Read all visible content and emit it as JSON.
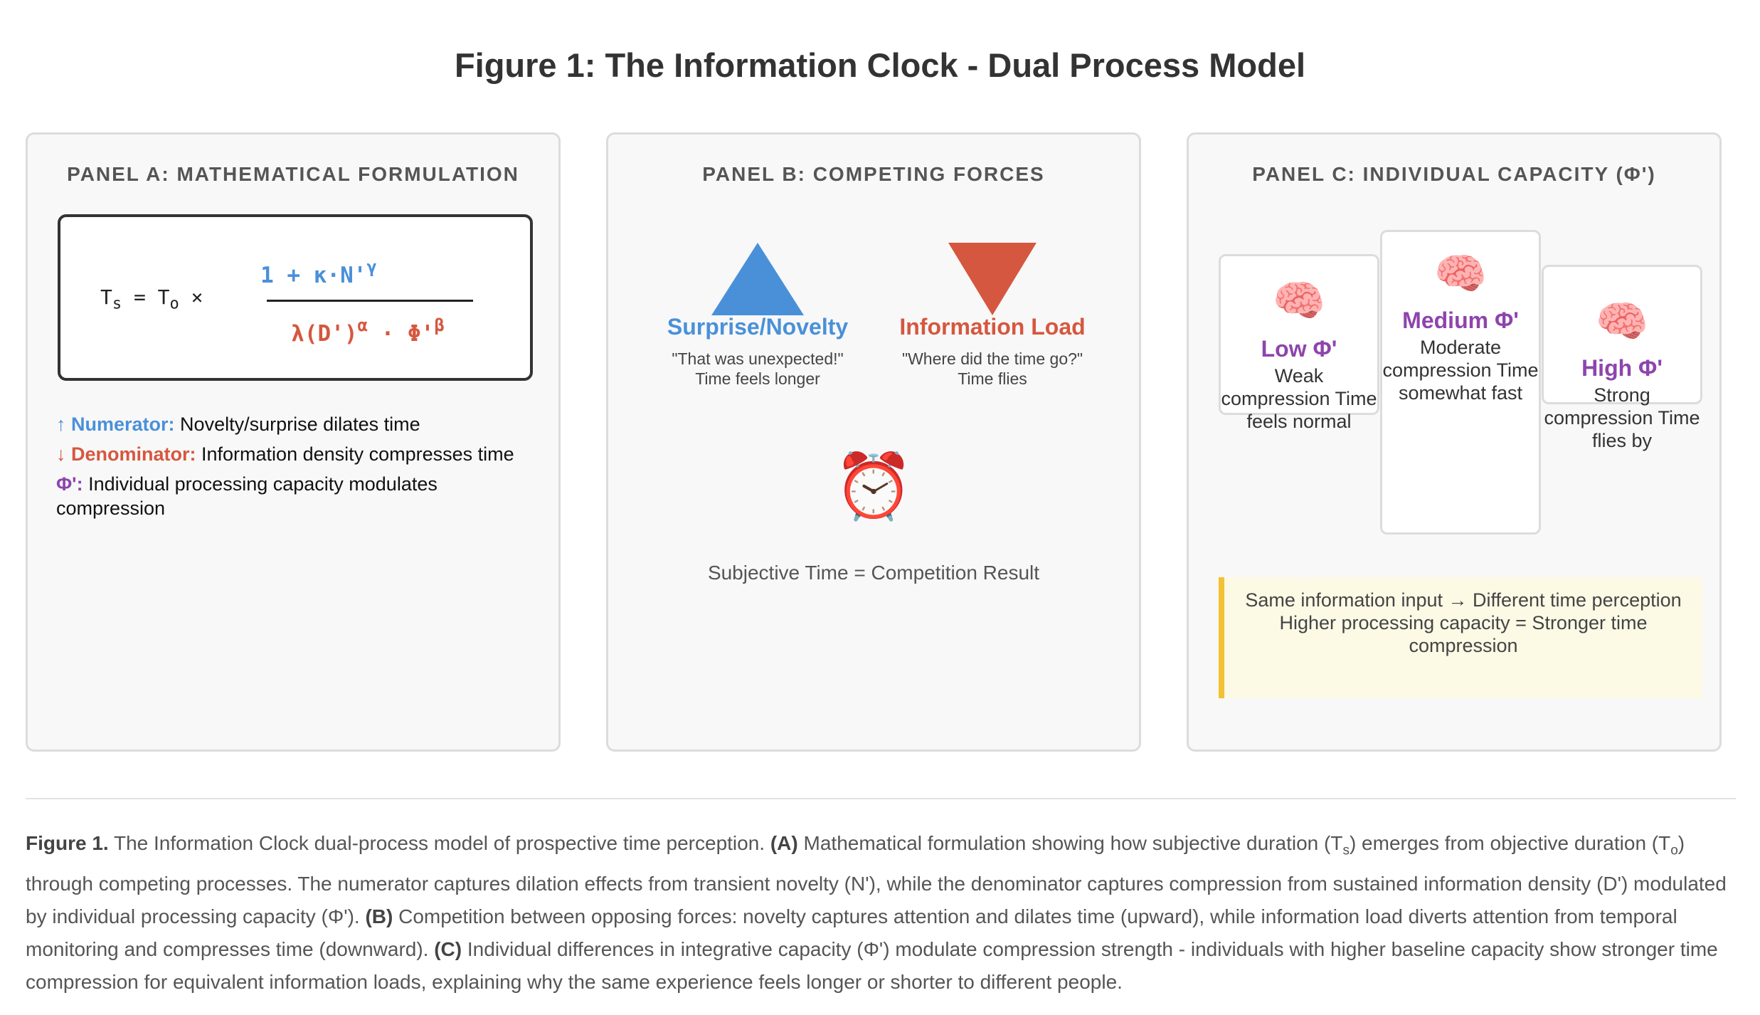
{
  "title": "Figure 1: The Information Clock - Dual Process Model",
  "panel_a": {
    "title": "PANEL A: MATHEMATICAL FORMULATION",
    "equation": {
      "lhs": "T",
      "lhs_sub": "s",
      "equals": "= T",
      "rhs_sub": "o",
      "times": "×",
      "numerator": "1 + κ·N'",
      "numerator_exp": "γ",
      "denominator_a": "λ(D')",
      "denominator_a_exp": "α",
      "denominator_b": " · Φ'",
      "denominator_b_exp": "β"
    },
    "legend": [
      {
        "arrow": "↑",
        "label": "Numerator:",
        "text": " Novelty/surprise dilates time"
      },
      {
        "arrow": "↓",
        "label": "Denominator:",
        "text": " Information density compresses time"
      },
      {
        "arrow": "",
        "label": "Φ':",
        "text": " Individual processing capacity modulates compression"
      }
    ]
  },
  "panel_b": {
    "title": "PANEL B: COMPETING FORCES",
    "surprise": {
      "name": "Surprise/Novelty",
      "quote": "\"That was unexpected!\"",
      "effect": "Time feels longer",
      "color": "#4a90d9"
    },
    "load": {
      "name": "Information Load",
      "quote": "\"Where did the time go?\"",
      "effect": "Time flies",
      "color": "#d6573f"
    },
    "clock_icon": "⏰",
    "result": "Subjective Time = Competition Result"
  },
  "panel_c": {
    "title": "PANEL C: INDIVIDUAL CAPACITY (Φ')",
    "brain_icon": "🧠",
    "cards": [
      {
        "level": "Low Φ'",
        "desc": "Weak compression Time feels normal"
      },
      {
        "level": "Medium Φ'",
        "desc": "Moderate compression Time somewhat fast"
      },
      {
        "level": "High Φ'",
        "desc": "Strong compression Time flies by"
      }
    ],
    "note_line1": "Same information input → Different time perception",
    "note_line2": "Higher processing capacity = Stronger time compression"
  },
  "caption": {
    "fig": "Figure 1.",
    "t1": " The Information Clock dual-process model of prospective time perception. ",
    "a": "(A)",
    "t2": " Mathematical formulation showing how subjective duration (T",
    "s": "s",
    "t3": ") emerges from objective duration (T",
    "o": "o",
    "t4": ") through competing processes. The numerator captures dilation effects from transient novelty (N'), while the denominator captures compression from sustained information density (D') modulated by individual processing capacity (Φ'). ",
    "b": "(B)",
    "t5": " Competition between opposing forces: novelty captures attention and dilates time (upward), while information load diverts attention from temporal monitoring and compresses time (downward). ",
    "c": "(C)",
    "t6": " Individual differences in integrative capacity (Φ') modulate compression strength - individuals with higher baseline capacity show stronger time compression for equivalent information loads, explaining why the same experience feels longer or shorter to different people."
  }
}
